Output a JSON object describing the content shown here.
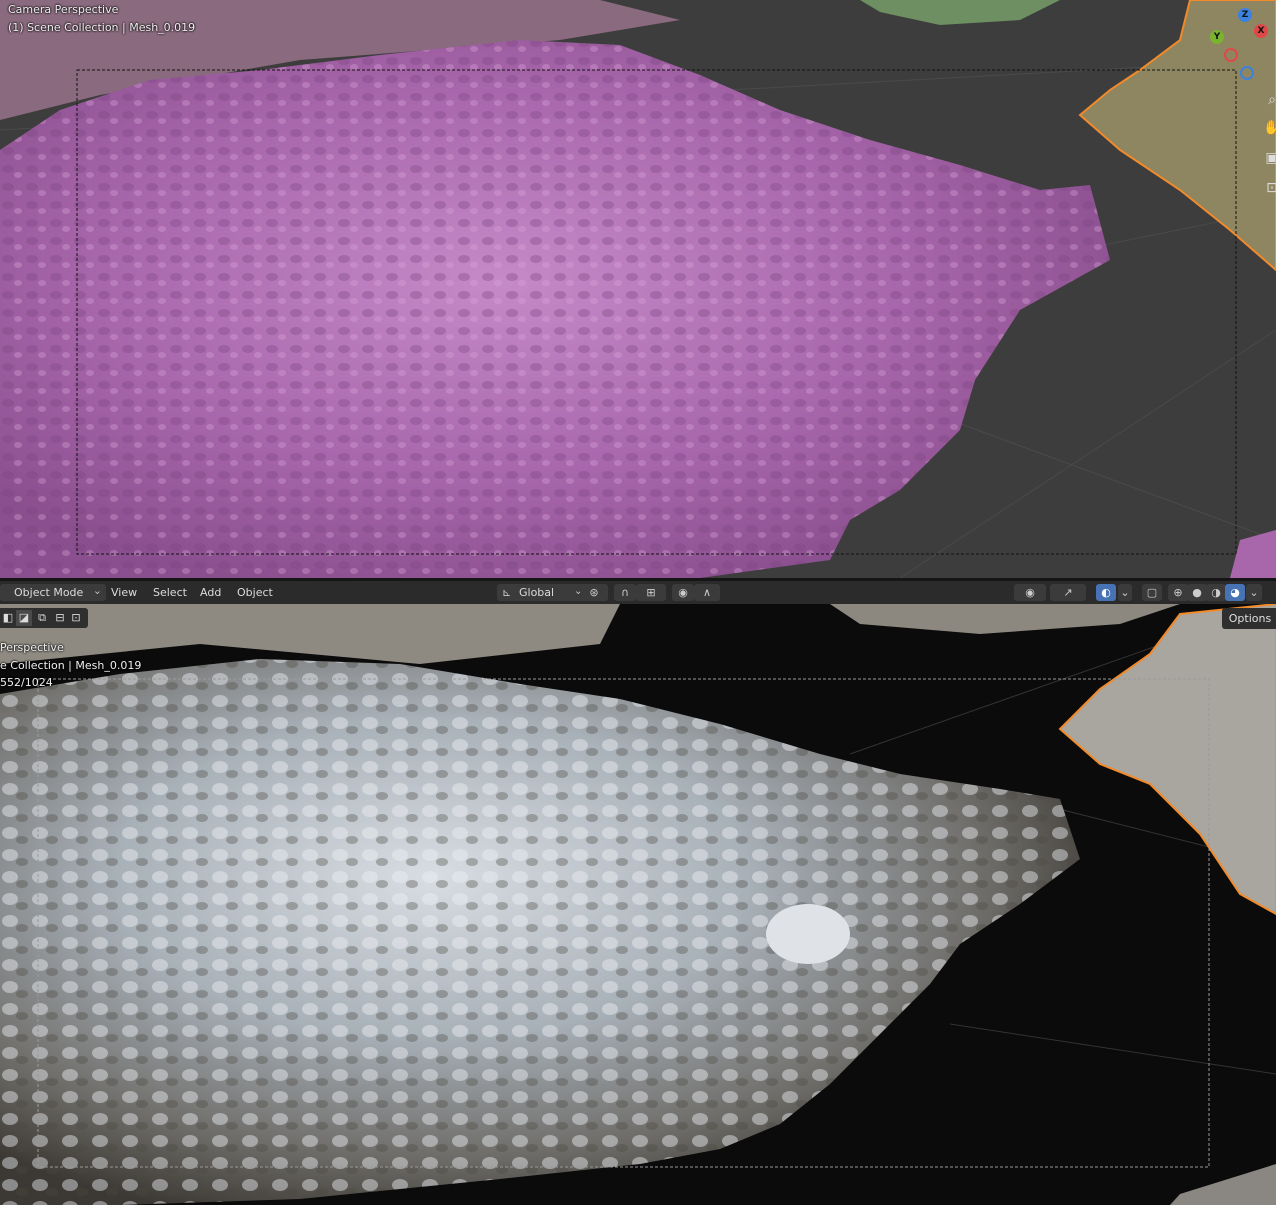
{
  "top_viewport": {
    "view_label": "Camera Perspective",
    "collection_info": "(1) Scene Collection | Mesh_0.019",
    "mesh_color": "#b070b4",
    "ground_color": "#3d3d3d"
  },
  "bottom_viewport": {
    "view_label": "Perspective",
    "collection_info": "e Collection | Mesh_0.019",
    "sample_count": "552/1024"
  },
  "header": {
    "mode": "Object Mode",
    "menus": [
      "View",
      "Select",
      "Add",
      "Object"
    ],
    "transform_orientation": "Global",
    "options_label": "Options"
  },
  "gizmo": {
    "z": "Z",
    "y": "Y",
    "x": "X",
    "colors": {
      "x": "#e04848",
      "y": "#7ab42f",
      "z": "#3b82e0"
    }
  },
  "icons": {
    "snap": "magnet-icon",
    "pivot": "pivot-icon",
    "proportional": "proportional-editing-icon",
    "visibility": "eye-icon",
    "gizmo_toggle": "gizmo-icon",
    "overlay": "overlay-icon",
    "xray": "xray-icon",
    "shading": [
      "wireframe-icon",
      "solid-icon",
      "material-preview-icon",
      "rendered-icon"
    ],
    "nav": [
      "zoom-icon",
      "hand-icon",
      "camera-icon",
      "lock-icon"
    ]
  }
}
